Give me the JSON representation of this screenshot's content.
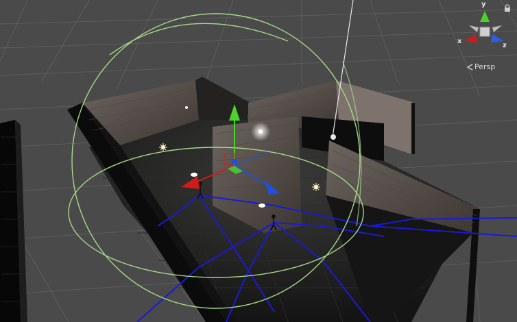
{
  "scene_view": {
    "projection_label": "Persp",
    "axis_labels": {
      "x": "x",
      "y": "y",
      "z": "z"
    },
    "gizmo_icons": [
      "scene-orientation-gizmo-icon",
      "lock-icon",
      "move-tool-gizmo-icon",
      "point-light-icon"
    ],
    "colors": {
      "background": "#4a4a4a",
      "grid": "#5b5b5b",
      "x_axis": "#d11a1a",
      "y_axis": "#4bd32a",
      "z_axis": "#1f4fe0",
      "light_range": "#a6d98a",
      "navmesh_lines": "#1a1ad6"
    }
  }
}
